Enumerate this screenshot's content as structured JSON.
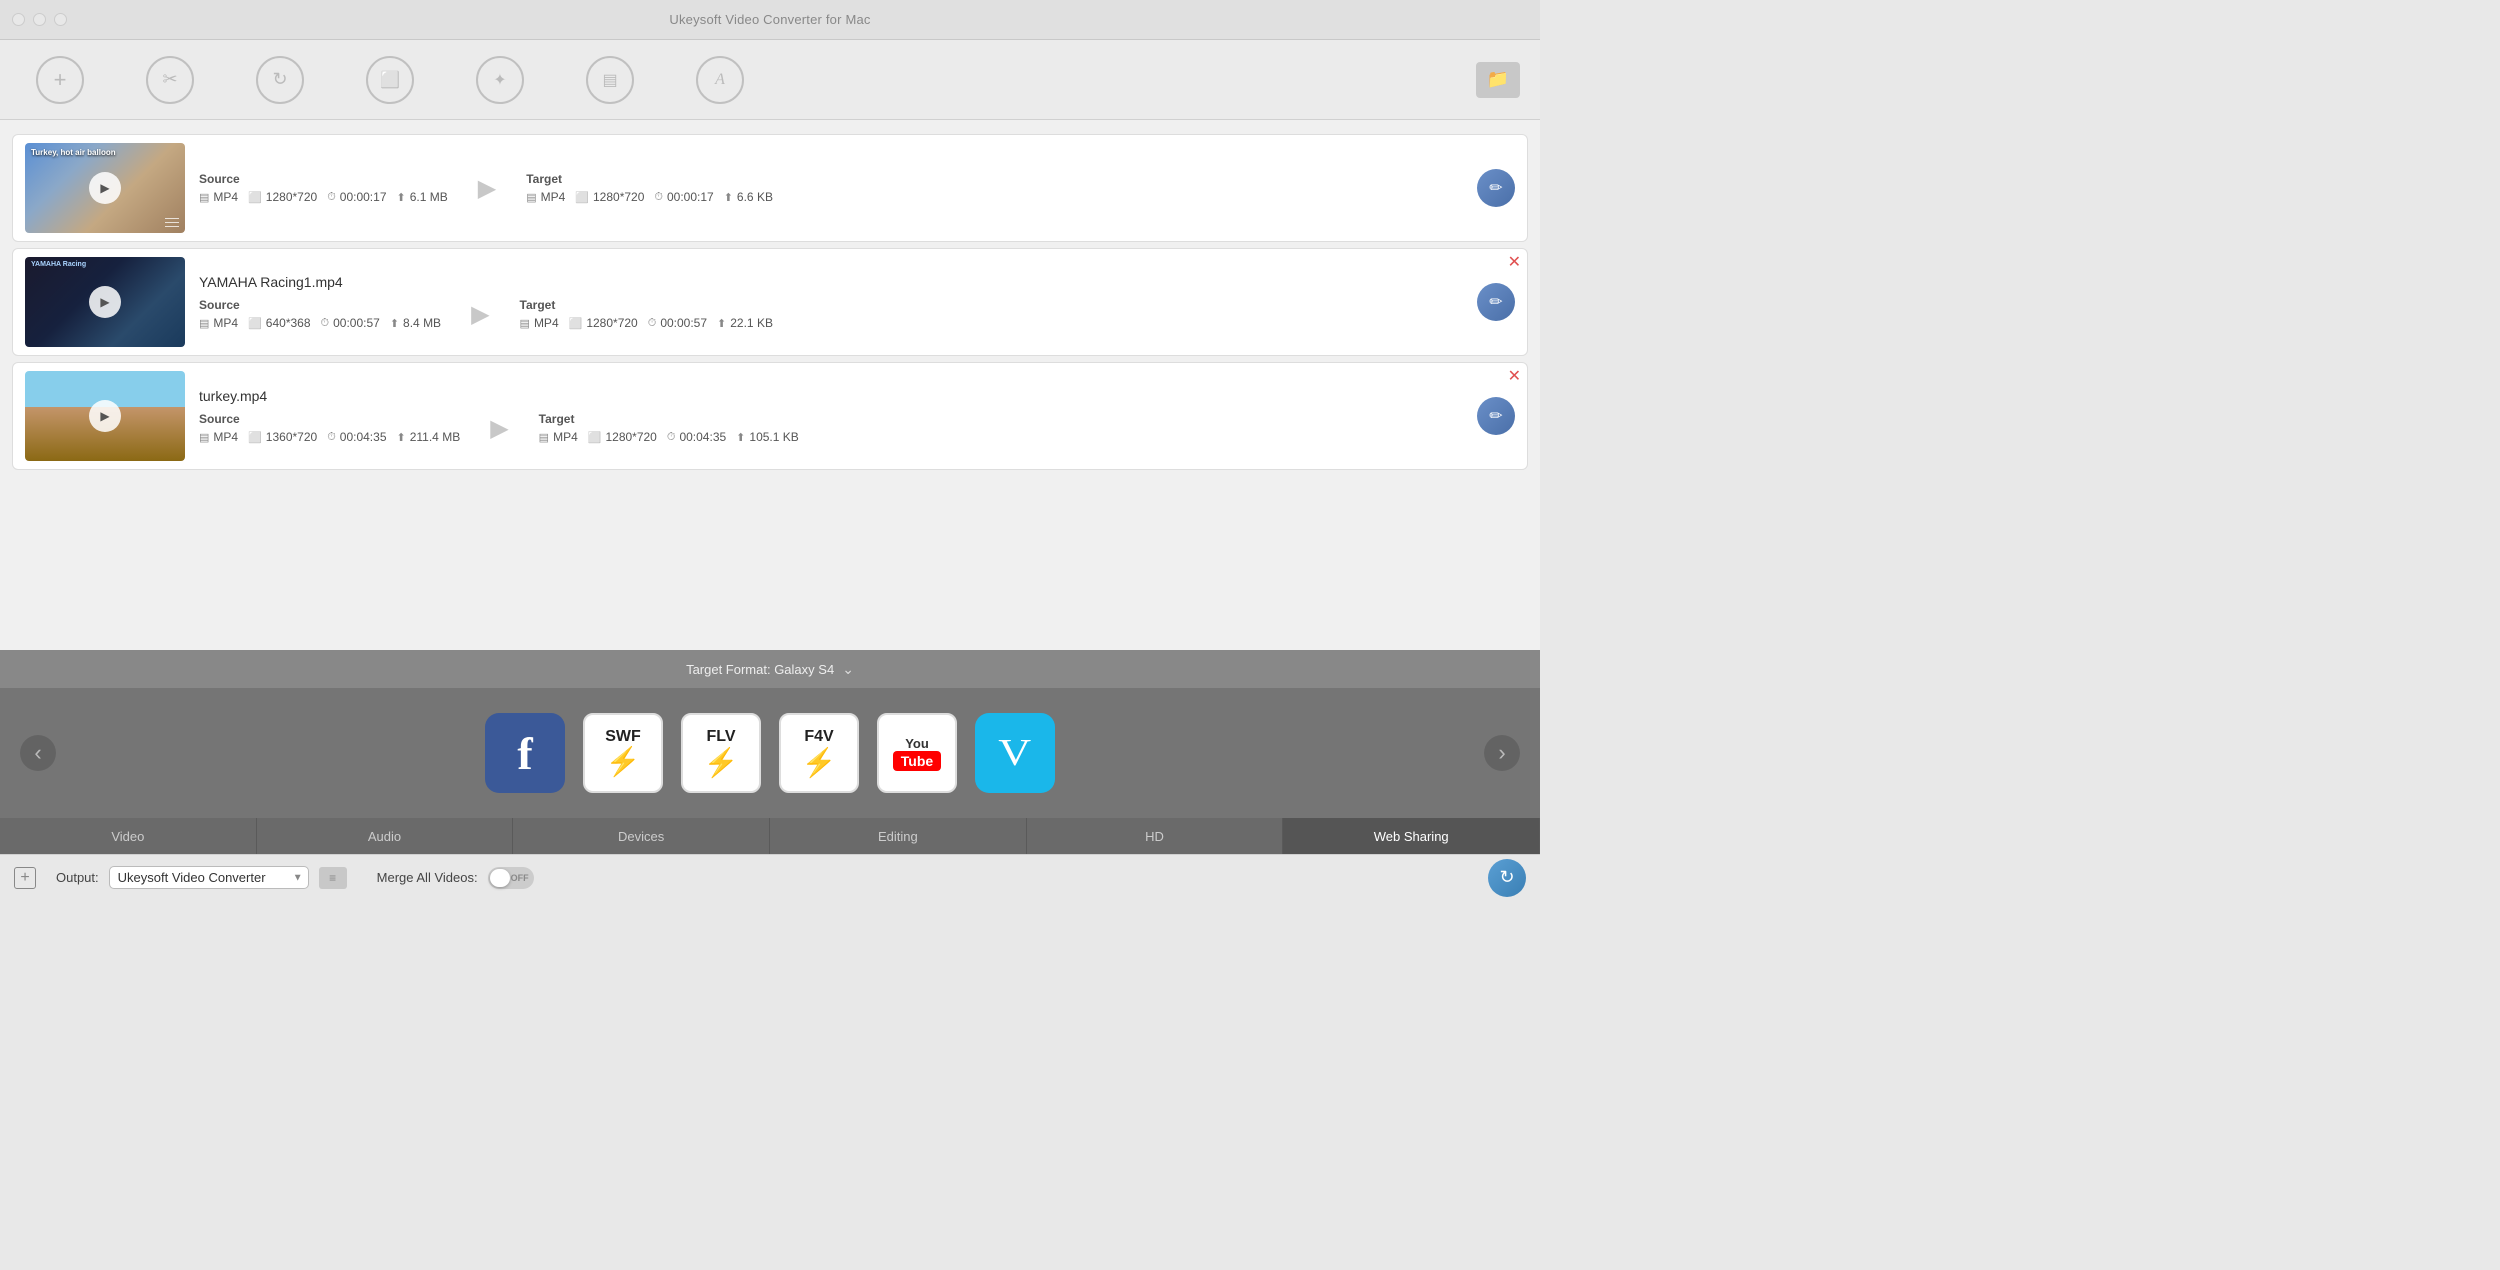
{
  "app": {
    "title": "Ukeysoft Video Converter for Mac"
  },
  "toolbar": {
    "buttons": [
      {
        "name": "add",
        "icon": "+",
        "label": "add-icon"
      },
      {
        "name": "cut",
        "icon": "✂",
        "label": "cut-icon"
      },
      {
        "name": "refresh",
        "icon": "↻",
        "label": "refresh-icon"
      },
      {
        "name": "crop",
        "icon": "⬛",
        "label": "crop-icon"
      },
      {
        "name": "effects",
        "icon": "✦",
        "label": "effects-icon"
      },
      {
        "name": "text",
        "icon": "T",
        "label": "text-icon"
      },
      {
        "name": "watermark",
        "icon": "A",
        "label": "watermark-icon"
      }
    ],
    "folder_icon": "📁"
  },
  "videos": [
    {
      "id": 1,
      "filename": "",
      "thumb_text": "Turkey, hot air balloon",
      "source": {
        "format": "MP4",
        "resolution": "1280*720",
        "duration": "00:00:17",
        "size": "6.1 MB"
      },
      "target": {
        "format": "MP4",
        "resolution": "1280*720",
        "duration": "00:00:17",
        "size": "6.6 KB"
      },
      "has_close": false
    },
    {
      "id": 2,
      "filename": "YAMAHA Racing1.mp4",
      "thumb_text": "",
      "source": {
        "format": "MP4",
        "resolution": "640*368",
        "duration": "00:00:57",
        "size": "8.4 MB"
      },
      "target": {
        "format": "MP4",
        "resolution": "1280*720",
        "duration": "00:00:57",
        "size": "22.1 KB"
      },
      "has_close": true
    },
    {
      "id": 3,
      "filename": "turkey.mp4",
      "thumb_text": "",
      "source": {
        "format": "MP4",
        "resolution": "1360*720",
        "duration": "00:04:35",
        "size": "211.4 MB"
      },
      "target": {
        "format": "MP4",
        "resolution": "1280*720",
        "duration": "00:04:35",
        "size": "105.1 KB"
      },
      "has_close": true
    }
  ],
  "format_bar": {
    "label": "Target Format: Galaxy S4",
    "chevron": "⌄"
  },
  "format_icons": [
    {
      "name": "facebook",
      "label": "Facebook"
    },
    {
      "name": "swf",
      "label": "SWF"
    },
    {
      "name": "flv",
      "label": "FLV"
    },
    {
      "name": "f4v",
      "label": "F4V"
    },
    {
      "name": "youtube",
      "label": "YouTube"
    },
    {
      "name": "vimeo",
      "label": "Vimeo"
    }
  ],
  "tabs": [
    {
      "name": "video",
      "label": "Video",
      "active": false
    },
    {
      "name": "audio",
      "label": "Audio",
      "active": false
    },
    {
      "name": "devices",
      "label": "Devices",
      "active": false
    },
    {
      "name": "editing",
      "label": "Editing",
      "active": false
    },
    {
      "name": "hd",
      "label": "HD",
      "active": false
    },
    {
      "name": "web-sharing",
      "label": "Web Sharing",
      "active": true
    }
  ],
  "bottom": {
    "add_icon": "+",
    "output_label": "Output:",
    "output_value": "Ukeysoft Video Converter",
    "output_placeholder": "Ukeysoft Video Converter",
    "folder_icon": "≡",
    "merge_label": "Merge All Videos:",
    "toggle_state": "OFF",
    "convert_icon": "↻"
  }
}
